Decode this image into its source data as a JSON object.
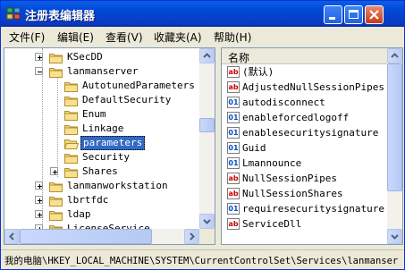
{
  "window": {
    "title": "注册表编辑器",
    "colors": {
      "titlebar": "#0a5ee6",
      "selection": "#316ac5",
      "string_icon": "#cc0000",
      "binary_icon": "#0050c8"
    }
  },
  "menu": [
    {
      "label": "文件(F)"
    },
    {
      "label": "编辑(E)"
    },
    {
      "label": "查看(V)"
    },
    {
      "label": "收藏夹(A)"
    },
    {
      "label": "帮助(H)"
    }
  ],
  "tree": {
    "items": [
      {
        "label": "KSecDD",
        "expander": "+",
        "level": 0
      },
      {
        "label": "lanmanserver",
        "expander": "-",
        "level": 0
      },
      {
        "label": "AutotunedParameters",
        "expander": "",
        "level": 1
      },
      {
        "label": "DefaultSecurity",
        "expander": "",
        "level": 1
      },
      {
        "label": "Enum",
        "expander": "",
        "level": 1
      },
      {
        "label": "Linkage",
        "expander": "",
        "level": 1
      },
      {
        "label": "parameters",
        "expander": "",
        "level": 1,
        "selected": true
      },
      {
        "label": "Security",
        "expander": "",
        "level": 1
      },
      {
        "label": "Shares",
        "expander": "+",
        "level": 1
      },
      {
        "label": "lanmanworkstation",
        "expander": "+",
        "level": 0
      },
      {
        "label": "lbrtfdc",
        "expander": "+",
        "level": 0
      },
      {
        "label": "ldap",
        "expander": "+",
        "level": 0
      },
      {
        "label": "LicenseService",
        "expander": "+",
        "level": 0
      }
    ]
  },
  "values_list": {
    "column_header": "名称",
    "items": [
      {
        "name": "(默认)",
        "type": "string",
        "icon_text": "ab"
      },
      {
        "name": "AdjustedNullSessionPipes",
        "type": "string",
        "icon_text": "ab"
      },
      {
        "name": "autodisconnect",
        "type": "binary",
        "icon_text": "01"
      },
      {
        "name": "enableforcedlogoff",
        "type": "binary",
        "icon_text": "01"
      },
      {
        "name": "enablesecuritysignature",
        "type": "binary",
        "icon_text": "01"
      },
      {
        "name": "Guid",
        "type": "binary",
        "icon_text": "01"
      },
      {
        "name": "Lmannounce",
        "type": "binary",
        "icon_text": "01"
      },
      {
        "name": "NullSessionPipes",
        "type": "string",
        "icon_text": "ab"
      },
      {
        "name": "NullSessionShares",
        "type": "string",
        "icon_text": "ab"
      },
      {
        "name": "requiresecuritysignature",
        "type": "binary",
        "icon_text": "01"
      },
      {
        "name": "ServiceDll",
        "type": "string",
        "icon_text": "ab"
      }
    ]
  },
  "statusbar": {
    "path": "我的电脑\\HKEY_LOCAL_MACHINE\\SYSTEM\\CurrentControlSet\\Services\\lanmanser"
  }
}
